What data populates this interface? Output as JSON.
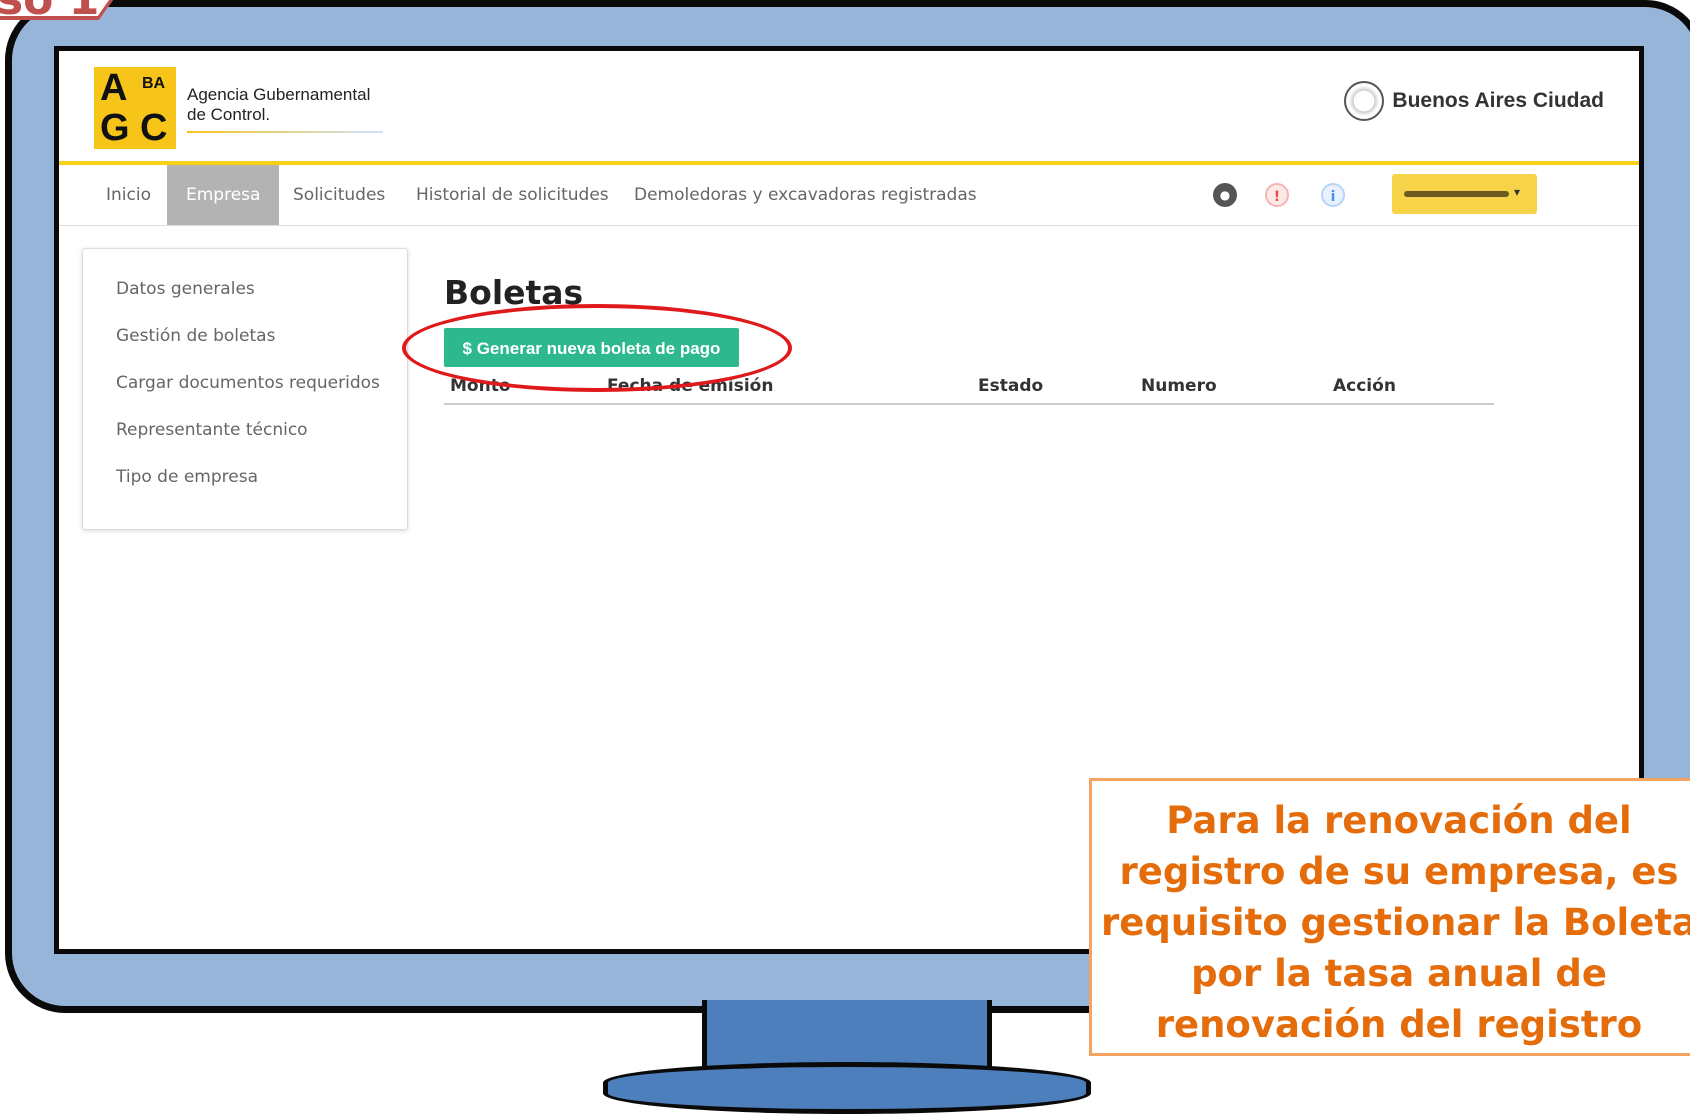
{
  "step_label": "so 1",
  "header": {
    "logo_letters": [
      "A",
      "BA",
      "G",
      "C"
    ],
    "org_name_line1": "Agencia Gubernamental",
    "org_name_line2": "de Control.",
    "city_name": "Buenos Aires Ciudad"
  },
  "nav": {
    "items": [
      "Inicio",
      "Empresa",
      "Solicitudes",
      "Historial de solicitudes",
      "Demoledoras y excavadoras registradas"
    ],
    "active": "Empresa",
    "icons": [
      {
        "name": "globe-icon",
        "glyph": "●",
        "color": "#555555"
      },
      {
        "name": "alert-icon",
        "glyph": "!",
        "color": "#e84a4a"
      },
      {
        "name": "info-icon",
        "glyph": "i",
        "color": "#4a90e2"
      }
    ]
  },
  "sidebar": {
    "items": [
      "Datos generales",
      "Gestión de boletas",
      "Cargar documentos requeridos",
      "Representante técnico",
      "Tipo de empresa"
    ]
  },
  "main": {
    "title": "Boletas",
    "generate_button": "$ Generar nueva boleta de pago",
    "table_headers": [
      "Monto",
      "Fecha de emisión",
      "Estado",
      "Numero",
      "Acción"
    ]
  },
  "callout": {
    "lines": [
      "Para la renovación del",
      "registro de su empresa, es",
      "requisito gestionar la Boleta",
      "por la tasa anual de",
      "renovación del registro"
    ]
  },
  "colors": {
    "monitor_frame": "#97b4d9",
    "accent_yellow": "#f7d117",
    "button_green": "#2db88d",
    "highlight_red": "#e01a1a",
    "callout_orange": "#e46c0a"
  }
}
